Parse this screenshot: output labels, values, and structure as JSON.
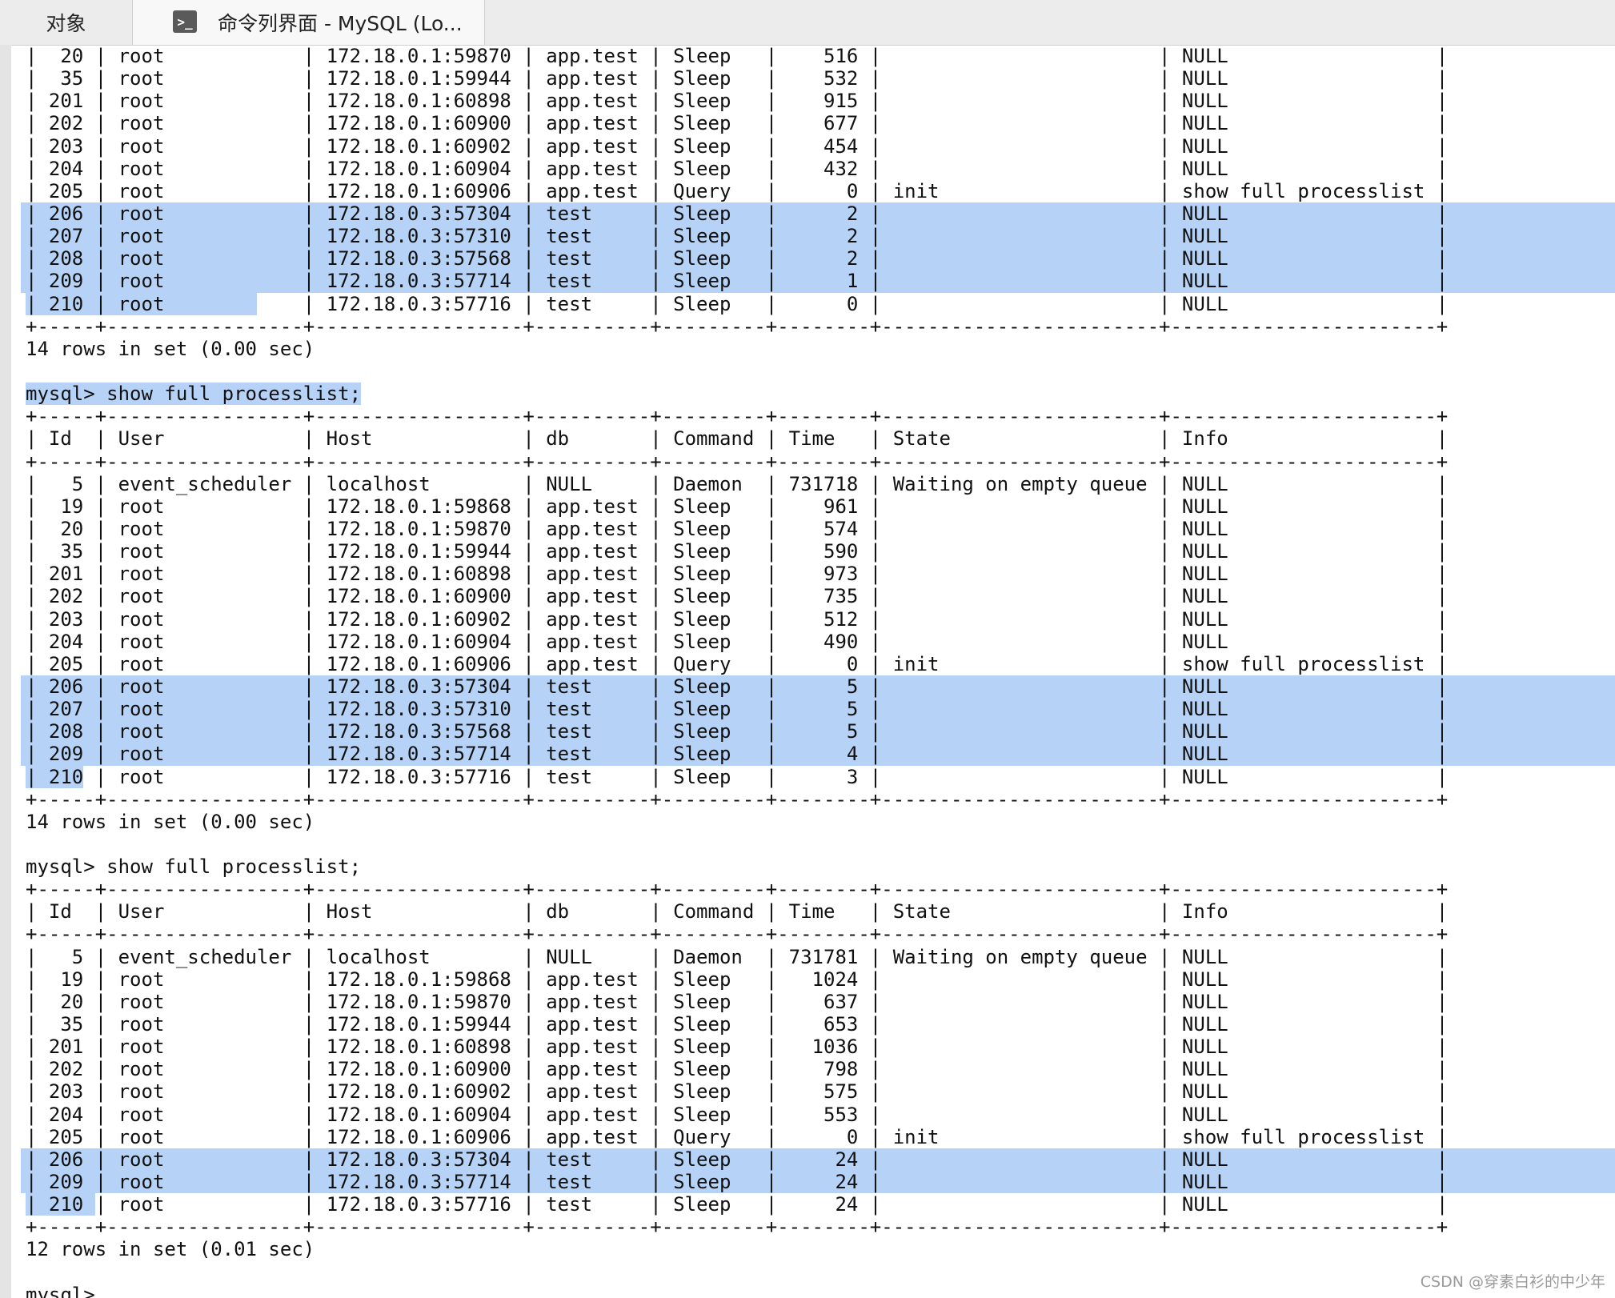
{
  "tabs": [
    {
      "label": "对象",
      "active": false
    },
    {
      "label": "命令列界面 - MySQL (Lo...",
      "active": true,
      "icon": "terminal-icon",
      "icon_glyph": ">_"
    }
  ],
  "selection_color": "#b6d3f7",
  "terminal": {
    "lines": [
      {
        "text": "|  20 | root            | 172.18.0.1:59870 | app.test | Sleep   |    516 |                        | NULL                  |"
      },
      {
        "text": "|  35 | root            | 172.18.0.1:59944 | app.test | Sleep   |    532 |                        | NULL                  |"
      },
      {
        "text": "| 201 | root            | 172.18.0.1:60898 | app.test | Sleep   |    915 |                        | NULL                  |"
      },
      {
        "text": "| 202 | root            | 172.18.0.1:60900 | app.test | Sleep   |    677 |                        | NULL                  |"
      },
      {
        "text": "| 203 | root            | 172.18.0.1:60902 | app.test | Sleep   |    454 |                        | NULL                  |"
      },
      {
        "text": "| 204 | root            | 172.18.0.1:60904 | app.test | Sleep   |    432 |                        | NULL                  |"
      },
      {
        "text": "| 205 | root            | 172.18.0.1:60906 | app.test | Query   |      0 | init                   | show full processlist |"
      },
      {
        "text": "| 206 | root            | 172.18.0.3:57304 | test     | Sleep   |      2 |                        | NULL                  |",
        "sel": "full"
      },
      {
        "text": "| 207 | root            | 172.18.0.3:57310 | test     | Sleep   |      2 |                        | NULL                  |",
        "sel": "full"
      },
      {
        "text": "| 208 | root            | 172.18.0.3:57568 | test     | Sleep   |      2 |                        | NULL                  |",
        "sel": "full"
      },
      {
        "text": "| 209 | root            | 172.18.0.3:57714 | test     | Sleep   |      1 |                        | NULL                  |",
        "sel": "full"
      },
      {
        "text": "| 210 | root            | 172.18.0.3:57716 | test     | Sleep   |      0 |                        | NULL                  |",
        "sel": "part",
        "sel_chars": 20
      },
      {
        "text": "+-----+-----------------+------------------+----------+---------+--------+------------------------+-----------------------+"
      },
      {
        "text": "14 rows in set (0.00 sec)"
      },
      {
        "text": ""
      },
      {
        "text": "mysql> show full processlist;",
        "sel": "part",
        "sel_chars": 29
      },
      {
        "text": "+-----+-----------------+------------------+----------+---------+--------+------------------------+-----------------------+"
      },
      {
        "text": "| Id  | User            | Host             | db       | Command | Time   | State                  | Info                  |"
      },
      {
        "text": "+-----+-----------------+------------------+----------+---------+--------+------------------------+-----------------------+"
      },
      {
        "text": "|   5 | event_scheduler | localhost        | NULL     | Daemon  | 731718 | Waiting on empty queue | NULL                  |"
      },
      {
        "text": "|  19 | root            | 172.18.0.1:59868 | app.test | Sleep   |    961 |                        | NULL                  |"
      },
      {
        "text": "|  20 | root            | 172.18.0.1:59870 | app.test | Sleep   |    574 |                        | NULL                  |"
      },
      {
        "text": "|  35 | root            | 172.18.0.1:59944 | app.test | Sleep   |    590 |                        | NULL                  |"
      },
      {
        "text": "| 201 | root            | 172.18.0.1:60898 | app.test | Sleep   |    973 |                        | NULL                  |"
      },
      {
        "text": "| 202 | root            | 172.18.0.1:60900 | app.test | Sleep   |    735 |                        | NULL                  |"
      },
      {
        "text": "| 203 | root            | 172.18.0.1:60902 | app.test | Sleep   |    512 |                        | NULL                  |"
      },
      {
        "text": "| 204 | root            | 172.18.0.1:60904 | app.test | Sleep   |    490 |                        | NULL                  |"
      },
      {
        "text": "| 205 | root            | 172.18.0.1:60906 | app.test | Query   |      0 | init                   | show full processlist |"
      },
      {
        "text": "| 206 | root            | 172.18.0.3:57304 | test     | Sleep   |      5 |                        | NULL                  |",
        "sel": "full"
      },
      {
        "text": "| 207 | root            | 172.18.0.3:57310 | test     | Sleep   |      5 |                        | NULL                  |",
        "sel": "full"
      },
      {
        "text": "| 208 | root            | 172.18.0.3:57568 | test     | Sleep   |      5 |                        | NULL                  |",
        "sel": "full"
      },
      {
        "text": "| 209 | root            | 172.18.0.3:57714 | test     | Sleep   |      4 |                        | NULL                  |",
        "sel": "full"
      },
      {
        "text": "| 210 | root            | 172.18.0.3:57716 | test     | Sleep   |      3 |                        | NULL                  |",
        "sel": "part",
        "sel_chars": 5
      },
      {
        "text": "+-----+-----------------+------------------+----------+---------+--------+------------------------+-----------------------+"
      },
      {
        "text": "14 rows in set (0.00 sec)"
      },
      {
        "text": ""
      },
      {
        "text": "mysql> show full processlist;"
      },
      {
        "text": "+-----+-----------------+------------------+----------+---------+--------+------------------------+-----------------------+"
      },
      {
        "text": "| Id  | User            | Host             | db       | Command | Time   | State                  | Info                  |"
      },
      {
        "text": "+-----+-----------------+------------------+----------+---------+--------+------------------------+-----------------------+"
      },
      {
        "text": "|   5 | event_scheduler | localhost        | NULL     | Daemon  | 731781 | Waiting on empty queue | NULL                  |"
      },
      {
        "text": "|  19 | root            | 172.18.0.1:59868 | app.test | Sleep   |   1024 |                        | NULL                  |"
      },
      {
        "text": "|  20 | root            | 172.18.0.1:59870 | app.test | Sleep   |    637 |                        | NULL                  |"
      },
      {
        "text": "|  35 | root            | 172.18.0.1:59944 | app.test | Sleep   |    653 |                        | NULL                  |"
      },
      {
        "text": "| 201 | root            | 172.18.0.1:60898 | app.test | Sleep   |   1036 |                        | NULL                  |"
      },
      {
        "text": "| 202 | root            | 172.18.0.1:60900 | app.test | Sleep   |    798 |                        | NULL                  |"
      },
      {
        "text": "| 203 | root            | 172.18.0.1:60902 | app.test | Sleep   |    575 |                        | NULL                  |"
      },
      {
        "text": "| 204 | root            | 172.18.0.1:60904 | app.test | Sleep   |    553 |                        | NULL                  |"
      },
      {
        "text": "| 205 | root            | 172.18.0.1:60906 | app.test | Query   |      0 | init                   | show full processlist |"
      },
      {
        "text": "| 206 | root            | 172.18.0.3:57304 | test     | Sleep   |     24 |                        | NULL                  |",
        "sel": "full"
      },
      {
        "text": "| 209 | root            | 172.18.0.3:57714 | test     | Sleep   |     24 |                        | NULL                  |",
        "sel": "full"
      },
      {
        "text": "| 210 | root            | 172.18.0.3:57716 | test     | Sleep   |     24 |                        | NULL                  |",
        "sel": "part",
        "sel_chars": 6
      },
      {
        "text": "+-----+-----------------+------------------+----------+---------+--------+------------------------+-----------------------+"
      },
      {
        "text": "12 rows in set (0.01 sec)"
      },
      {
        "text": ""
      },
      {
        "text": "mysql>"
      }
    ]
  },
  "watermark": "CSDN @穿素白衫的中少年"
}
